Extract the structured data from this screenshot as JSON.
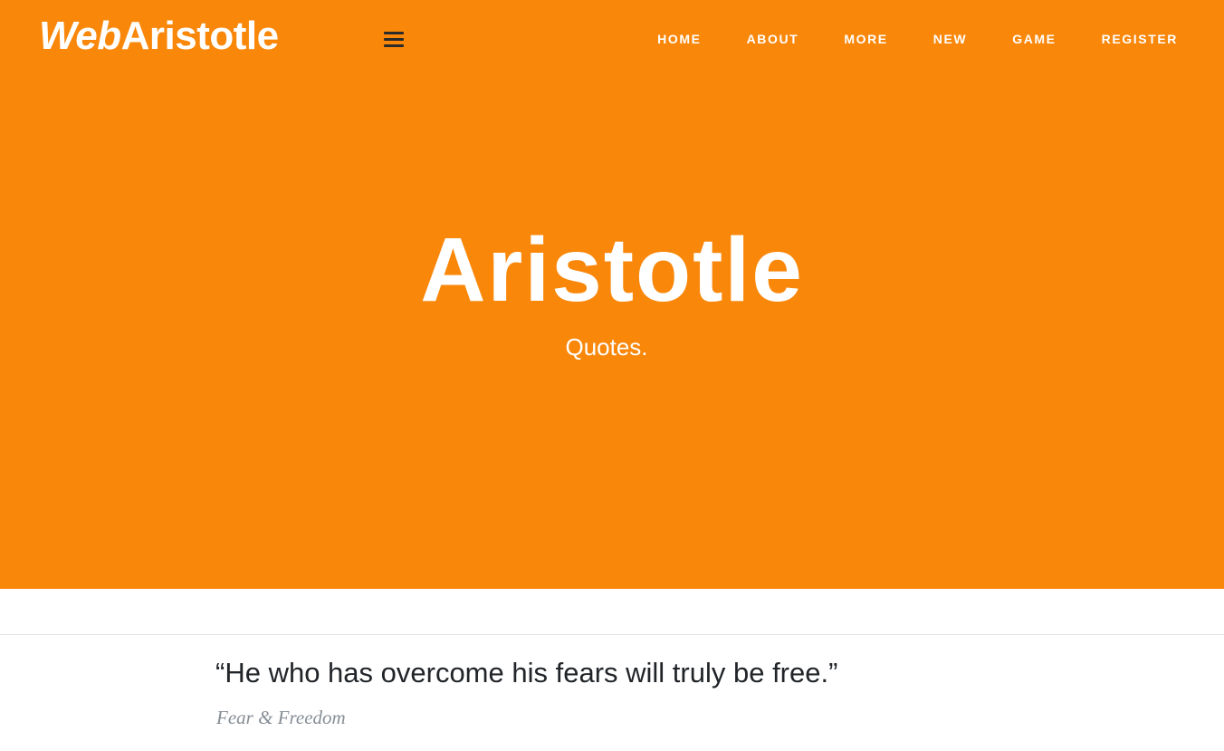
{
  "header": {
    "brand_part1": "Web",
    "brand_part2": "Aristotle",
    "nav": [
      "HOME",
      "ABOUT",
      "MORE",
      "NEW",
      "GAME",
      "REGISTER"
    ]
  },
  "hero": {
    "title": "Aristotle",
    "subtitle": "Quotes.",
    "background_color": "#f9870a"
  },
  "quote": {
    "text": "“He who has overcome his fears will truly be free.”",
    "tag": "Fear & Freedom"
  }
}
